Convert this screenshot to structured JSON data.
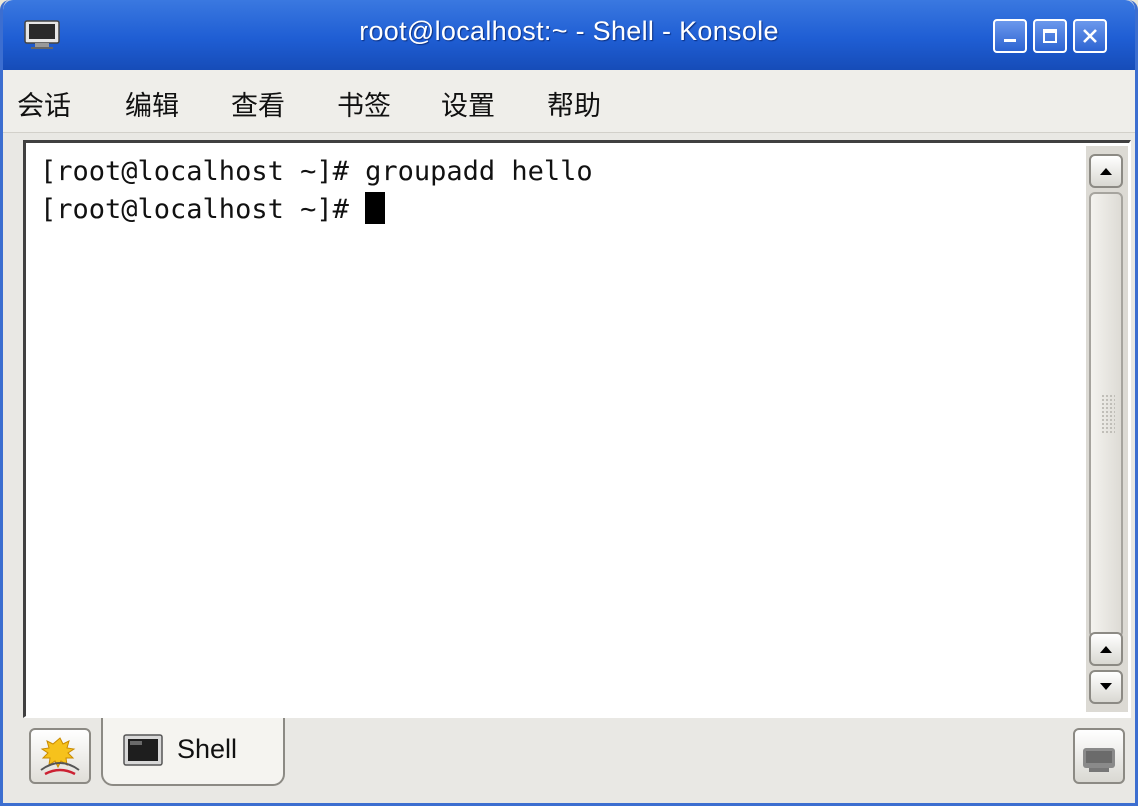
{
  "window": {
    "title": "root@localhost:~ - Shell - Konsole",
    "accent": "#1f5ed4"
  },
  "menu": {
    "items": [
      "会话",
      "编辑",
      "查看",
      "书签",
      "设置",
      "帮助"
    ]
  },
  "terminal": {
    "lines": [
      "[root@localhost ~]# groupadd hello",
      "[root@localhost ~]# "
    ]
  },
  "tabs": {
    "items": [
      {
        "label": "Shell",
        "icon": "terminal-icon"
      }
    ]
  },
  "icons": {
    "app": "konsole-monitor-icon",
    "new_session": "new-session-icon",
    "close_session": "close-session-icon"
  }
}
